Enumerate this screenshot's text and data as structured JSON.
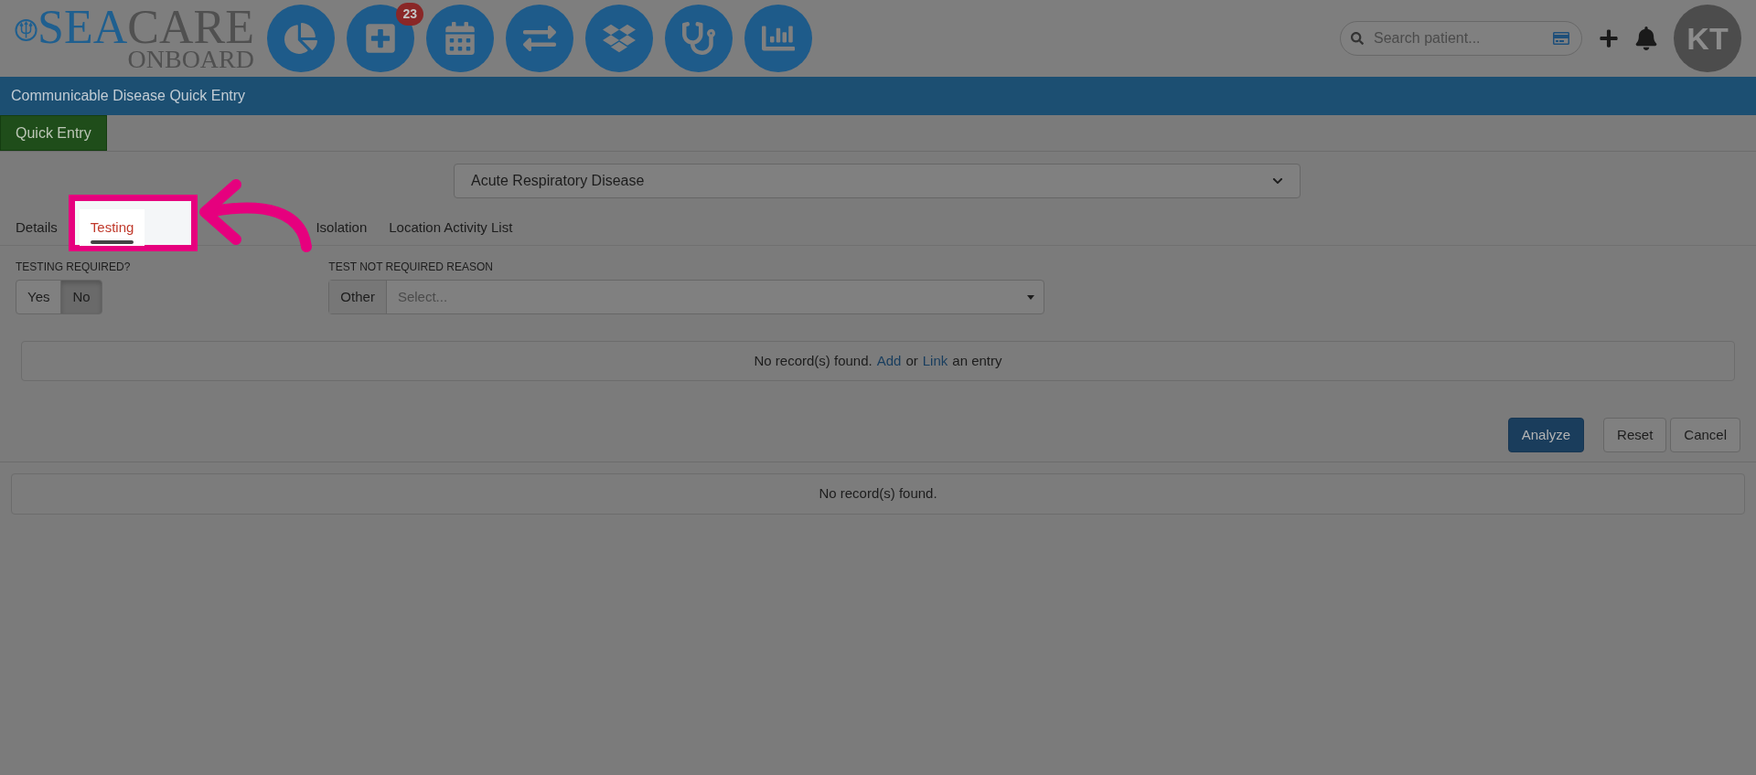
{
  "header": {
    "logo": {
      "primary": "SEA",
      "secondary": "CARE",
      "sub": "ONBOARD"
    },
    "nav_icons": [
      {
        "kind": "pie"
      },
      {
        "kind": "add",
        "badge": "23"
      },
      {
        "kind": "calendar"
      },
      {
        "kind": "exchange"
      },
      {
        "kind": "boxes"
      },
      {
        "kind": "stethoscope"
      },
      {
        "kind": "bars"
      }
    ],
    "search": {
      "placeholder": "Search patient..."
    },
    "avatar": "KT"
  },
  "page_title": "Communicable Disease Quick Entry",
  "top_tabs": [
    {
      "label": "Quick Entry",
      "selected": true
    }
  ],
  "disease_select": {
    "value": "Acute Respiratory Disease"
  },
  "tabs": [
    {
      "label": "Details",
      "selected": false,
      "highlighted": false
    },
    {
      "label": "Testing",
      "selected": true,
      "highlighted": true
    },
    {
      "label": "Isolation",
      "selected": false,
      "highlighted": false
    },
    {
      "label": "Location Activity List",
      "selected": false,
      "highlighted": false
    }
  ],
  "testing_required": {
    "label": "TESTING REQUIRED?",
    "options": [
      {
        "label": "Yes",
        "selected": false
      },
      {
        "label": "No",
        "selected": true
      }
    ]
  },
  "reason": {
    "label": "TEST NOT REQUIRED REASON",
    "addon": "Other",
    "placeholder": "Select..."
  },
  "tests_panel": {
    "text": "No record(s) found.",
    "add_link": "Add",
    "joiner": "or",
    "link_link": "Link",
    "suffix": "an entry"
  },
  "buttons": [
    {
      "label": "Analyze",
      "kind": "primary"
    },
    {
      "label": "Reset",
      "kind": "default"
    },
    {
      "label": "Cancel",
      "kind": "default"
    }
  ],
  "results_panel": {
    "text": "No record(s) found."
  }
}
